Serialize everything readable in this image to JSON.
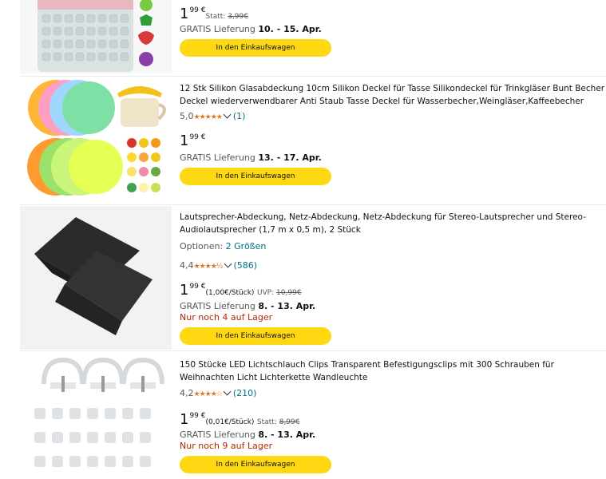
{
  "results": [
    {
      "price_whole": "1",
      "price_fraction": "99 €",
      "price_note": "",
      "strike_label": "Statt: ",
      "strike_price": "3,99€",
      "delivery_prefix": "GRATIS Lieferung ",
      "delivery_dates": "10. - 15. Apr.",
      "button_label": "In den Einkaufswagen"
    },
    {
      "title": "12 Stk Silikon Glasabdeckung 10cm Silikon Deckel für Tasse Silikondeckel für Trinkgläser Bunt Becher Deckel wiederverwendbarer Anti Staub Tasse Deckel für Wasserbecher,Weingläser,Kaffeebecher",
      "rating": "5,0",
      "stars": "★★★★★",
      "review_count": "(1)",
      "price_whole": "1",
      "price_fraction": "99 €",
      "delivery_prefix": "GRATIS Lieferung ",
      "delivery_dates": "13. - 17. Apr.",
      "button_label": "In den Einkaufswagen"
    },
    {
      "title": "Lautsprecher-Abdeckung, Netz-Abdeckung, Netz-Abdeckung für Stereo-Lautsprecher und Stereo-Audiolautsprecher (1,7 m x 0,5 m), 2 Stück",
      "options_label": "Optionen: ",
      "options_link": "2 Größen",
      "rating": "4,4",
      "stars": "★★★★½",
      "review_count": "(586)",
      "price_whole": "1",
      "price_fraction": "99 €",
      "price_note": "(1,00€/Stück)",
      "strike_label": "UVP: ",
      "strike_price": "10,99€",
      "delivery_prefix": "GRATIS Lieferung ",
      "delivery_dates": "8. - 13. Apr.",
      "stock": "Nur noch 4 auf Lager",
      "button_label": "In den Einkaufswagen"
    },
    {
      "title": "150 Stücke LED Lichtschlauch Clips Transparent Befestigungsclips mit 300 Schrauben für Weihnachten Licht Lichterkette Wandleuchte",
      "rating": "4,2",
      "stars": "★★★★☆",
      "review_count": "(210)",
      "price_whole": "1",
      "price_fraction": "99 €",
      "price_note": "(0,01€/Stück)",
      "strike_label": "Statt: ",
      "strike_price": "8,99€",
      "delivery_prefix": "GRATIS Lieferung ",
      "delivery_dates": "8. - 13. Apr.",
      "stock": "Nur noch 9 auf Lager",
      "button_label": "In den Einkaufswagen"
    }
  ]
}
